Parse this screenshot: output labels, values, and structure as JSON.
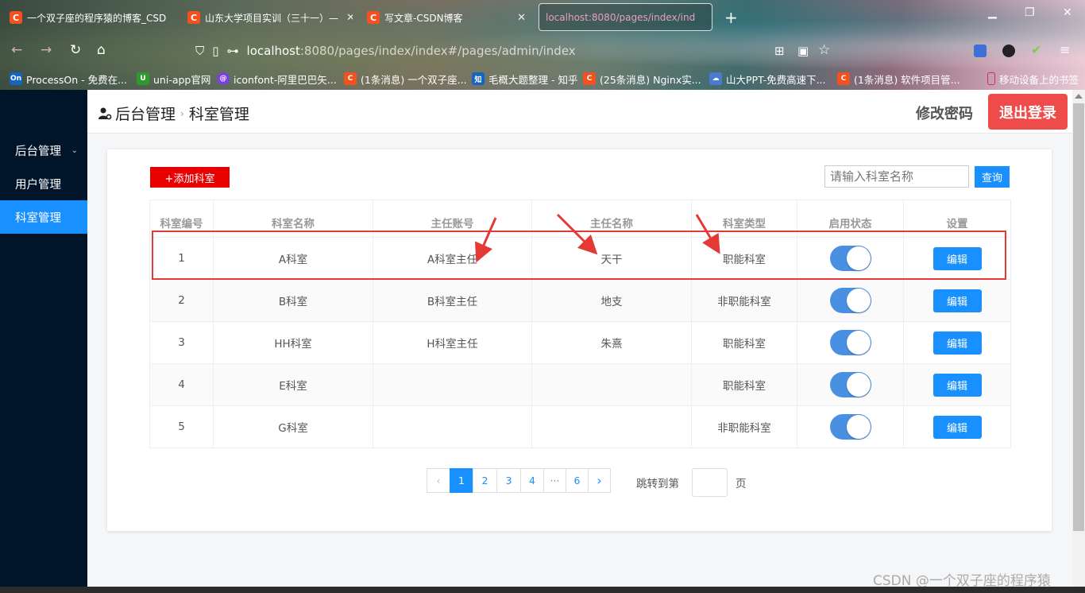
{
  "browser": {
    "tabs": [
      {
        "label": "一个双子座的程序猿的博客_CSD",
        "favicon": "C"
      },
      {
        "label": "山东大学项目实训（三十一）—",
        "favicon": "C"
      },
      {
        "label": "写文章-CSDN博客",
        "favicon": "C"
      },
      {
        "label": "localhost:8080/pages/index/ind",
        "favicon": ""
      }
    ],
    "new_tab": "+",
    "url_host": "localhost",
    "url_path": ":8080/pages/index/index#/pages/admin/index",
    "bookmarks": [
      {
        "label": "ProcessOn - 免费在...",
        "icon": "On",
        "color": "#1565c0"
      },
      {
        "label": "uni-app官网",
        "icon": "U",
        "color": "#2e9a2e"
      },
      {
        "label": "iconfont-阿里巴巴矢...",
        "icon": "@",
        "color": "#7b3fe4"
      },
      {
        "label": "(1条消息) 一个双子座...",
        "icon": "C",
        "color": "#f4511e"
      },
      {
        "label": "毛概大题整理 - 知乎",
        "icon": "知",
        "color": "#1565c0"
      },
      {
        "label": "(25条消息) Nginx实...",
        "icon": "C",
        "color": "#f4511e"
      },
      {
        "label": "山大PPT-免费高速下...",
        "icon": "☁",
        "color": "#4a7bd0"
      },
      {
        "label": "(1条消息) 软件项目管...",
        "icon": "C",
        "color": "#f4511e"
      },
      {
        "label": "移动设备上的书签",
        "icon": "",
        "color": "#cc3344"
      }
    ]
  },
  "sidebar": {
    "items": [
      {
        "label": "后台管理",
        "caret": "⌄"
      },
      {
        "label": "用户管理"
      },
      {
        "label": "科室管理"
      }
    ]
  },
  "header": {
    "crumb_root": "后台管理",
    "crumb_current": "科室管理",
    "change_password": "修改密码",
    "logout": "退出登录"
  },
  "toolbar": {
    "add_label": "+添加科室",
    "search_placeholder": "请输入科室名称",
    "search_label": "查询"
  },
  "table": {
    "columns": [
      "科室编号",
      "科室名称",
      "主任账号",
      "主任名称",
      "科室类型",
      "启用状态",
      "设置"
    ],
    "rows": [
      {
        "id": "1",
        "name": "A科室",
        "director_account": "A科室主任",
        "director_name": "天干",
        "type": "职能科室",
        "enabled": true,
        "action": "编辑"
      },
      {
        "id": "2",
        "name": "B科室",
        "director_account": "B科室主任",
        "director_name": "地支",
        "type": "非职能科室",
        "enabled": true,
        "action": "编辑"
      },
      {
        "id": "3",
        "name": "HH科室",
        "director_account": "H科室主任",
        "director_name": "朱熹",
        "type": "职能科室",
        "enabled": true,
        "action": "编辑"
      },
      {
        "id": "4",
        "name": "E科室",
        "director_account": "",
        "director_name": "",
        "type": "职能科室",
        "enabled": true,
        "action": "编辑"
      },
      {
        "id": "5",
        "name": "G科室",
        "director_account": "",
        "director_name": "",
        "type": "非职能科室",
        "enabled": true,
        "action": "编辑"
      }
    ]
  },
  "pagination": {
    "prev": "‹",
    "pages": [
      "1",
      "2",
      "3",
      "4",
      "···",
      "6"
    ],
    "current": "1",
    "next": "›",
    "goto_label": "跳转到第",
    "goto_unit": "页"
  },
  "watermark": "CSDN @一个双子座的程序猿",
  "colors": {
    "sidebar_bg": "#001529",
    "primary": "#1890ff",
    "add_button": "#e80000",
    "logout": "#ef4b4b",
    "annotation": "#e53935"
  }
}
